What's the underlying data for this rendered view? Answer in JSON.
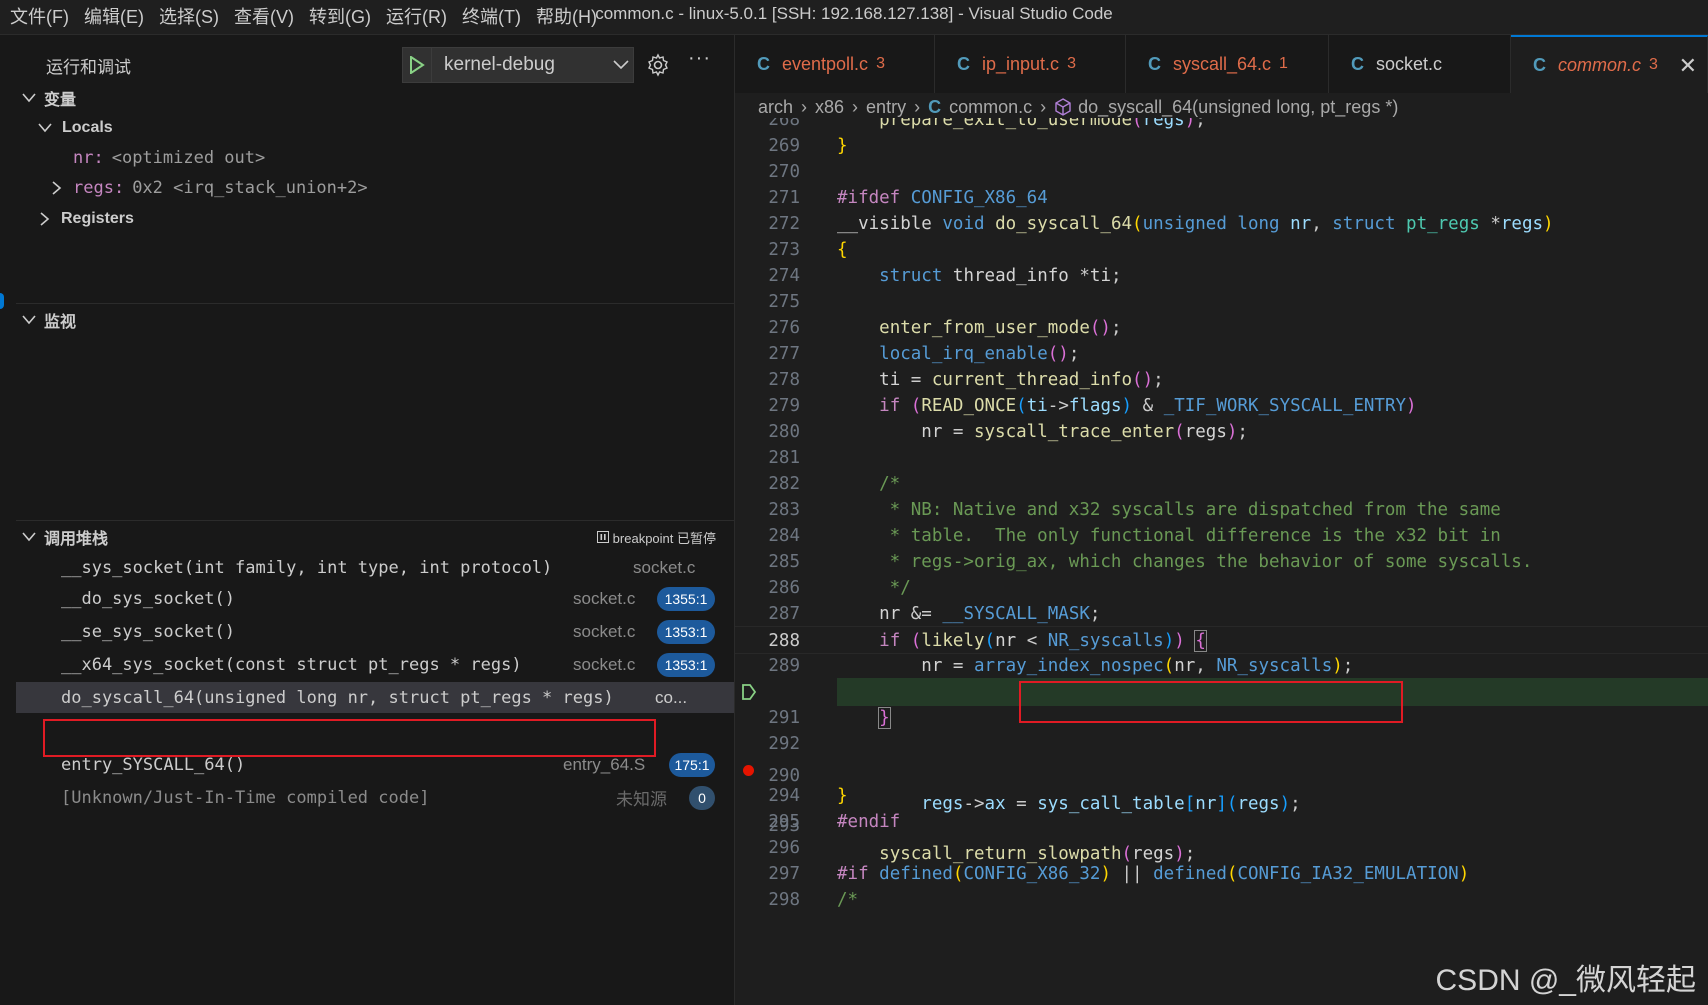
{
  "menu": [
    "文件(F)",
    "编辑(E)",
    "选择(S)",
    "查看(V)",
    "转到(G)",
    "运行(R)",
    "终端(T)",
    "帮助(H)"
  ],
  "window_title": "common.c - linux-5.0.1 [SSH: 192.168.127.138] - Visual Studio Code",
  "sidebar": {
    "title": "运行和调试",
    "config": "kernel-debug",
    "more": "···",
    "variables": {
      "header": "变量",
      "locals": "Locals",
      "nr_name": "nr:",
      "nr_value": "<optimized out>",
      "regs_name": "regs:",
      "regs_value": "0x2 <irq_stack_union+2>",
      "registers": "Registers"
    },
    "watch": {
      "header": "监视"
    },
    "callstack": {
      "header": "调用堆栈",
      "status": "breakpoint 已暂停",
      "frames": [
        {
          "fn": "__sys_socket(int family, int type, int protocol)",
          "file": "socket.c",
          "line": ""
        },
        {
          "fn": "__do_sys_socket()",
          "file": "socket.c",
          "line": "1355:1"
        },
        {
          "fn": "__se_sys_socket()",
          "file": "socket.c",
          "line": "1353:1"
        },
        {
          "fn": "__x64_sys_socket(const struct pt_regs * regs)",
          "file": "socket.c",
          "line": "1353:1"
        },
        {
          "fn": "do_syscall_64(unsigned long nr, struct pt_regs * regs)",
          "file": "co...",
          "line": ""
        },
        {
          "fn": "entry_SYSCALL_64()",
          "file": "entry_64.S",
          "line": "175:1"
        },
        {
          "fn": "[Unknown/Just-In-Time compiled code]",
          "file": "未知源",
          "line": "0"
        }
      ]
    }
  },
  "tabs": [
    {
      "name": "eventpoll.c",
      "badge": "3"
    },
    {
      "name": "ip_input.c",
      "badge": "3"
    },
    {
      "name": "syscall_64.c",
      "badge": "1"
    },
    {
      "name": "socket.c",
      "badge": ""
    },
    {
      "name": "common.c",
      "badge": "3"
    }
  ],
  "breadcrumb": {
    "parts": [
      "arch",
      "x86",
      "entry"
    ],
    "file": "common.c",
    "symbol": "do_syscall_64(unsigned long, pt_regs *)"
  },
  "code": {
    "line_numbers": [
      "268",
      "269",
      "270",
      "271",
      "272",
      "273",
      "274",
      "275",
      "276",
      "277",
      "278",
      "279",
      "280",
      "281",
      "282",
      "283",
      "284",
      "285",
      "286",
      "287",
      "288",
      "289",
      "290",
      "291",
      "292",
      "293",
      "294",
      "295",
      "296",
      "297",
      "298"
    ],
    "current_line": "288",
    "paused_line": "290",
    "breakpoint_line": "293"
  },
  "watermark": "CSDN @_微风轻起"
}
